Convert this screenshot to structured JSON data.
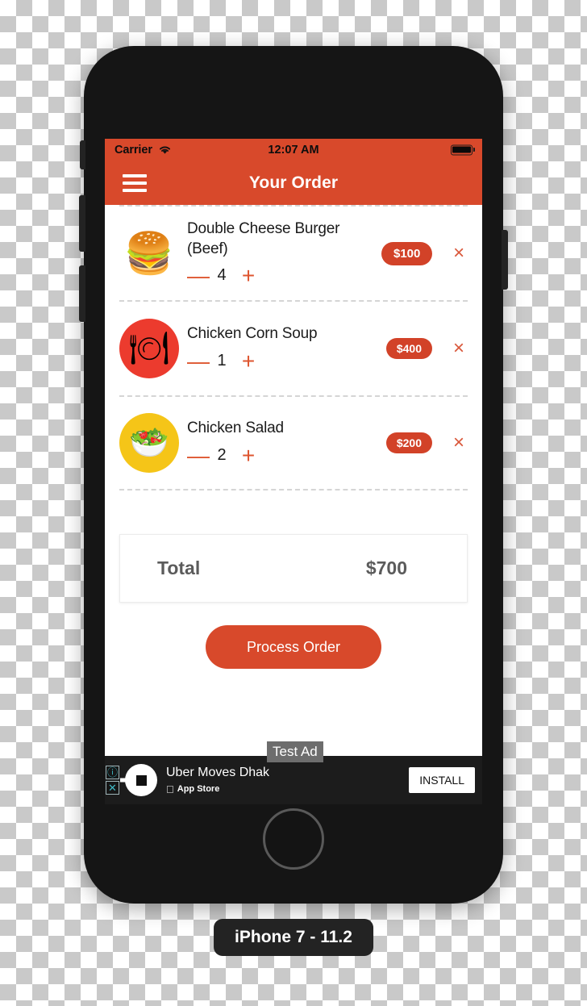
{
  "status_bar": {
    "carrier": "Carrier",
    "wifi_icon": "wifi-icon",
    "time": "12:07 AM",
    "battery_icon": "battery-full-icon"
  },
  "nav_bar": {
    "menu_icon": "hamburger-menu-icon",
    "title": "Your Order"
  },
  "order": {
    "items": [
      {
        "icon": "🍔",
        "icon_name": "hamburger-food-icon",
        "name": "Double Cheese Burger (Beef)",
        "quantity": "4",
        "price": "$100",
        "decrement_label": "—",
        "increment_label": "+",
        "remove_label": "×"
      },
      {
        "icon": "🍽",
        "icon_name": "plate-cutlery-icon",
        "name": "Chicken Corn Soup",
        "quantity": "1",
        "price": "$400",
        "decrement_label": "—",
        "increment_label": "+",
        "remove_label": "×"
      },
      {
        "icon": "🥗",
        "icon_name": "salad-bowl-icon",
        "name": "Chicken Salad",
        "quantity": "2",
        "price": "$200",
        "decrement_label": "—",
        "increment_label": "+",
        "remove_label": "×"
      }
    ],
    "total_label": "Total",
    "total_value": "$700",
    "process_order_label": "Process Order"
  },
  "ad_banner": {
    "info_icon": "ⓘ",
    "close_icon": "✕",
    "logo_name": "uber-logo-icon",
    "title": "Uber Moves Dhak",
    "store_label": "App Store",
    "apple_glyph": "",
    "install_label": "INSTALL",
    "test_ad_label": "Test Ad"
  },
  "device": {
    "label": "iPhone 7 - 11.2"
  },
  "colors": {
    "accent_red": "#d8492b",
    "pill_red": "#d24228",
    "stepper_orange": "#de5630",
    "thumb_red": "#ec3b2e",
    "thumb_yellow": "#f5c518",
    "ad_teal": "#3fb8c4"
  }
}
